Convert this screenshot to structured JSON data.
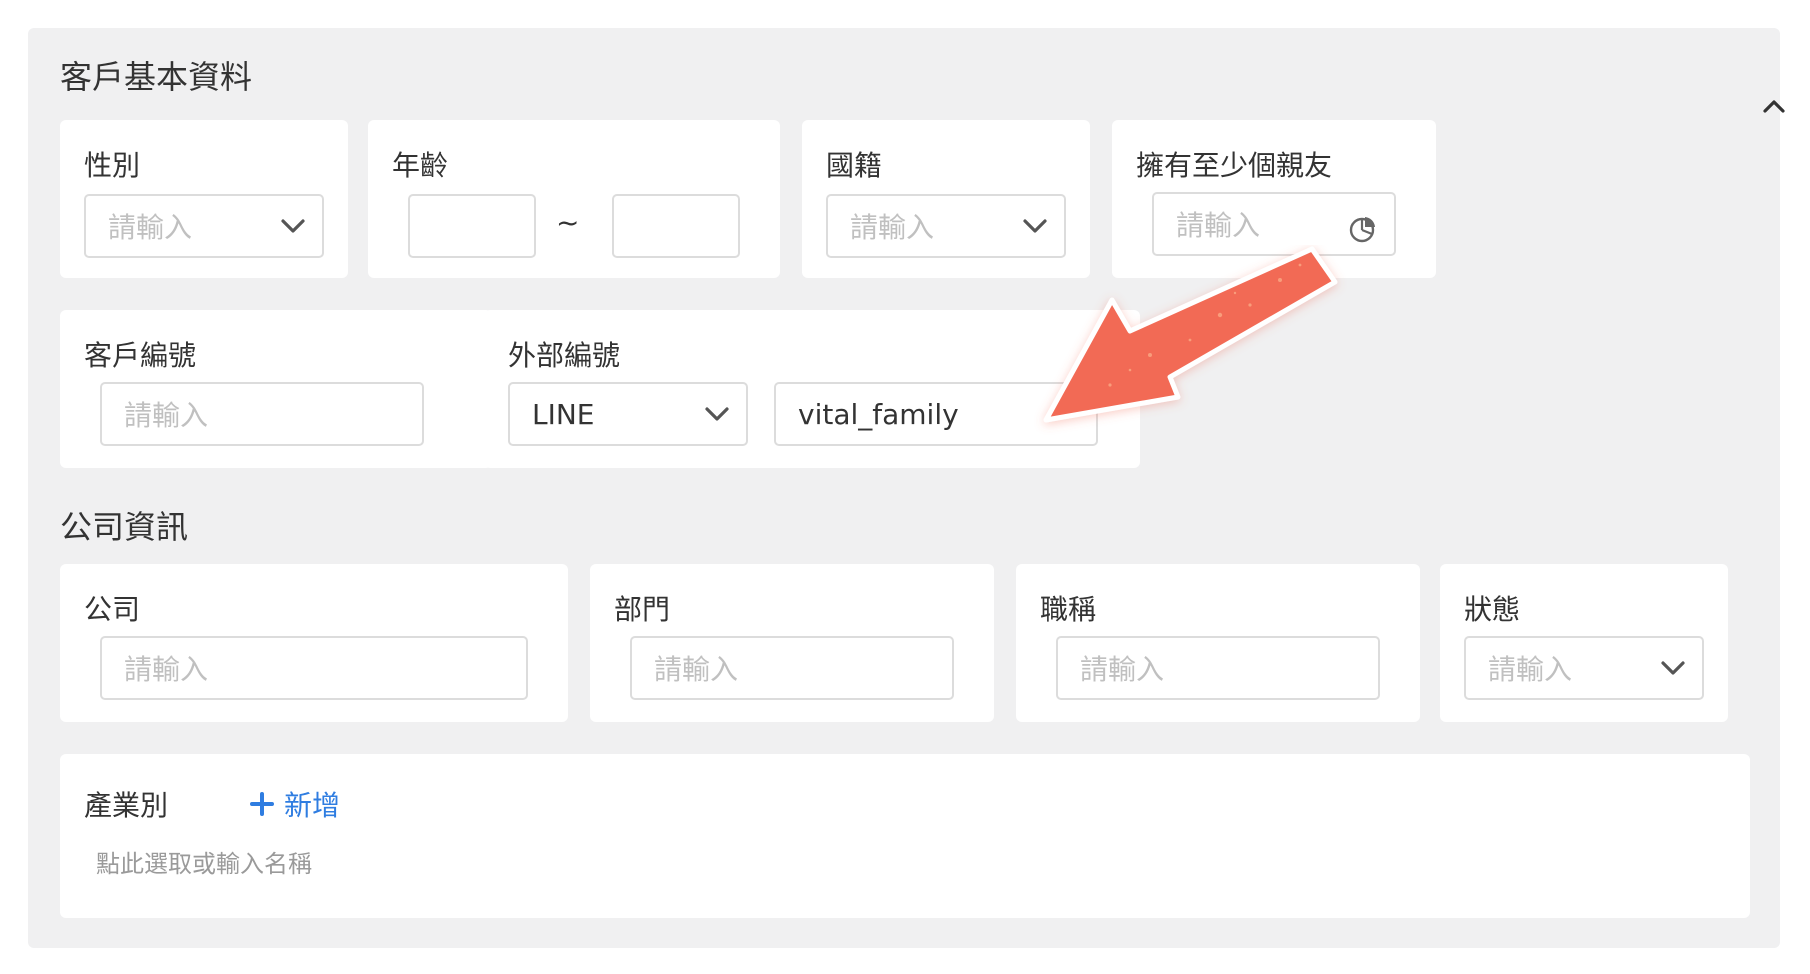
{
  "basic": {
    "title": "客戶基本資料",
    "gender": {
      "label": "性別",
      "placeholder": "請輸入"
    },
    "age": {
      "label": "年齡",
      "separator": "~"
    },
    "nationality": {
      "label": "國籍",
      "placeholder": "請輸入"
    },
    "friends": {
      "label": "擁有至少個親友",
      "placeholder": "請輸入"
    },
    "customer_id": {
      "label": "客戶編號",
      "placeholder": "請輸入"
    },
    "external_id": {
      "label": "外部編號",
      "source": "LINE",
      "value": "vital_family"
    }
  },
  "company": {
    "title": "公司資訊",
    "company": {
      "label": "公司",
      "placeholder": "請輸入"
    },
    "department": {
      "label": "部門",
      "placeholder": "請輸入"
    },
    "job_title": {
      "label": "職稱",
      "placeholder": "請輸入"
    },
    "status": {
      "label": "狀態",
      "placeholder": "請輸入"
    },
    "industry": {
      "label": "產業別",
      "add_label": "新增",
      "hint": "點此選取或輸入名稱"
    }
  },
  "colors": {
    "accent": "#2f7de1",
    "arrow": "#f26a55",
    "panel": "#f0f0f1"
  },
  "icons": {
    "collapse": "chevron-up-icon",
    "dropdown": "chevron-down-icon",
    "friends": "pie-chart-icon",
    "add": "plus-icon"
  }
}
